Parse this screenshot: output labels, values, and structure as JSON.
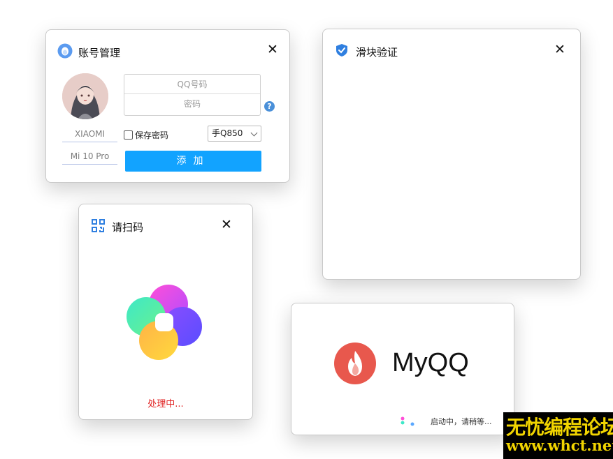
{
  "account_window": {
    "title": "账号管理",
    "qq_placeholder": "QQ号码",
    "password_placeholder": "密码",
    "help_label": "?",
    "device_brand": "XIAOMI",
    "device_model": "Mi 10 Pro",
    "save_password_label": "保存密码",
    "protocol_selected": "手Q850",
    "add_button_label": "添加",
    "close_label": "✕"
  },
  "slider_window": {
    "title": "滑块验证",
    "close_label": "✕"
  },
  "scan_window": {
    "title": "请扫码",
    "status": "处理中...",
    "close_label": "✕"
  },
  "startup_window": {
    "app_name": "MyQQ",
    "status": "启动中，请稍等..."
  },
  "watermark": {
    "line1": "无忧编程论坛",
    "line2": "www.whct.net"
  },
  "colors": {
    "primary_button": "#12a3ff",
    "processing_text": "#e02020",
    "logo_red": "#e8584d",
    "watermark_yellow": "#f1d400"
  }
}
